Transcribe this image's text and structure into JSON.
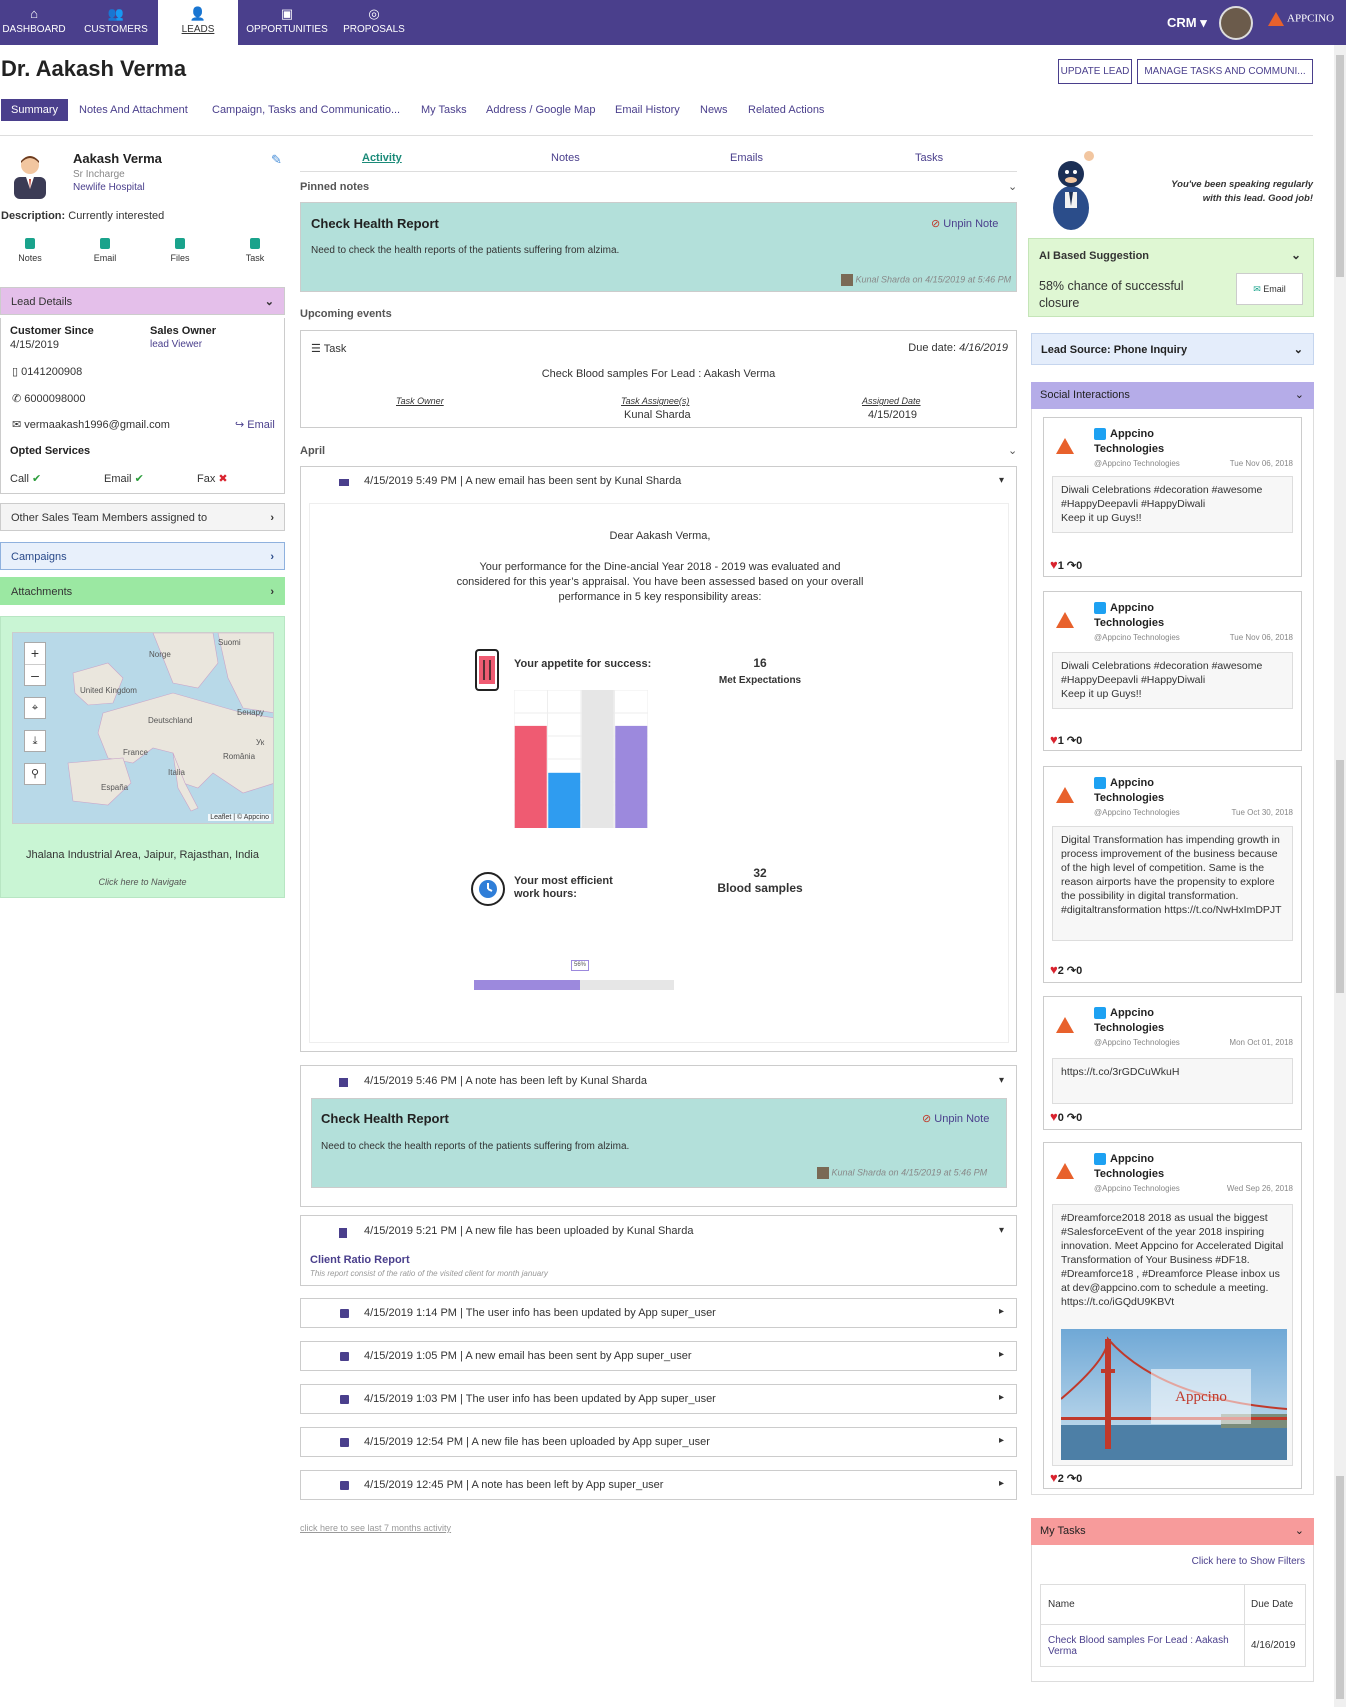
{
  "nav": {
    "items": [
      {
        "label": "DASHBOARD",
        "icon": "home-icon"
      },
      {
        "label": "CUSTOMERS",
        "icon": "users-icon"
      },
      {
        "label": "LEADS",
        "icon": "leads-icon"
      },
      {
        "label": "OPPORTUNITIES",
        "icon": "briefcase-icon"
      },
      {
        "label": "PROPOSALS",
        "icon": "handshake-icon"
      }
    ],
    "crm_label": "CRM",
    "logo_text": "APPCINO"
  },
  "header": {
    "title": "Dr. Aakash Verma",
    "update_btn": "UPDATE LEAD",
    "manage_btn": "MANAGE TASKS AND COMMUNI..."
  },
  "subtabs": [
    "Summary",
    "Notes And Attachment",
    "Campaign, Tasks and Communicatio...",
    "My Tasks",
    "Address / Google Map",
    "Email History",
    "News",
    "Related Actions"
  ],
  "profile": {
    "name": "Aakash Verma",
    "role": "Sr Incharge",
    "org": "Newlife Hospital",
    "desc_label": "Description:",
    "desc_value": "Currently interested",
    "actions": [
      "Notes",
      "Email",
      "Files",
      "Task"
    ]
  },
  "lead_details": {
    "title": "Lead Details",
    "customer_since_label": "Customer Since",
    "customer_since": "4/15/2019",
    "sales_owner_label": "Sales Owner",
    "sales_owner": "lead Viewer",
    "phone1": "0141200908",
    "phone2": "6000098000",
    "email": "vermaakash1996@gmail.com",
    "email_link": "Email",
    "opted_label": "Opted Services",
    "services": [
      {
        "name": "Call",
        "on": true
      },
      {
        "name": "Email",
        "on": true
      },
      {
        "name": "Fax",
        "on": false
      }
    ]
  },
  "panels": {
    "sales_team": "Other Sales Team Members assigned to",
    "campaigns": "Campaigns",
    "attachments": "Attachments"
  },
  "map": {
    "labels": [
      "Suomi",
      "Norge",
      "United Kingdom",
      "Deutschland",
      "France",
      "Italia",
      "España",
      "România",
      "Бенару",
      "Ук"
    ],
    "attribution": "Leaflet | © Appcino",
    "zoom_in": "+",
    "zoom_out": "–",
    "address": "Jhalana Industrial Area, Jaipur, Rajasthan, India",
    "navigate": "Click here to Navigate"
  },
  "center_tabs": [
    "Activity",
    "Notes",
    "Emails",
    "Tasks"
  ],
  "pinned": {
    "label": "Pinned notes",
    "title": "Check Health Report",
    "unpin": "Unpin Note",
    "body": "Need to check the health reports of the patients suffering from alzima.",
    "meta": "Kunal Sharda on 4/15/2019 at 5:46 PM"
  },
  "upcoming": {
    "label": "Upcoming events",
    "type": "Task",
    "due_label": "Due date:",
    "due": "4/16/2019",
    "subject": "Check Blood samples For Lead : Aakash Verma",
    "owner_label": "Task Owner",
    "assignee_label": "Task Assignee(s)",
    "assignee": "Kunal Sharda",
    "assigned_label": "Assigned Date",
    "assigned": "4/15/2019"
  },
  "month_label": "April",
  "email_activity": {
    "header": "4/15/2019 5:49 PM | A new email has been sent by Kunal Sharda",
    "greeting": "Dear Aakash  Verma,",
    "para": "Your performance for the Dine-ancial Year 2018 - 2019 was evaluated and considered for this year’s appraisal. You have been assessed based on your overall performance in 5 key responsibility areas:",
    "kpi1_label": "Your appetite for success:",
    "kpi1_value": "16",
    "kpi1_caption": "Met Expectations",
    "kpi2_label": "Your most efficient work hours:",
    "kpi2_value": "32",
    "kpi2_caption": "Blood samples",
    "progress_label": "56%",
    "progress": 0.53
  },
  "chart_data": {
    "type": "bar",
    "categories": [
      "",
      "",
      "",
      ""
    ],
    "values": [
      74,
      40,
      100,
      74
    ],
    "colors": [
      "#ef5b72",
      "#2f9cf0",
      "#e6e6e6",
      "#9c89dd"
    ],
    "ylim": [
      0,
      100
    ],
    "grid": true
  },
  "note_activity": {
    "header": "4/15/2019 5:46 PM | A note has been left by Kunal Sharda",
    "title": "Check Health Report",
    "unpin": "Unpin Note",
    "body": "Need to check the health reports of the patients suffering from alzima.",
    "meta": "Kunal Sharda on 4/15/2019 at 5:46 PM"
  },
  "file_activity": {
    "header": "4/15/2019 5:21 PM | A new file has been uploaded by Kunal Sharda",
    "title": "Client Ratio Report",
    "desc": "This report consist of the ratio of the visited client for month january"
  },
  "activity_rows": [
    "4/15/2019 1:14 PM | The user info has been updated by App super_user",
    "4/15/2019 1:05 PM | A new email has been sent by App super_user",
    "4/15/2019 1:03 PM | The user info has been updated by App super_user",
    "4/15/2019 12:54 PM | A new file has been uploaded by App super_user",
    "4/15/2019 12:45 PM | A note has been left by App super_user"
  ],
  "see_more": "click here to see last 7 months activity",
  "right": {
    "bubble": "You've been speaking regularly with this lead. Good job!",
    "ai_title": "AI Based Suggestion",
    "ai_text": "58% chance of successful closure",
    "ai_btn": "Email",
    "lead_source": "Lead Source: Phone Inquiry",
    "social_title": "Social Interactions",
    "tweets": [
      {
        "name": "Appcino Technologies",
        "handle": "@Appcino Technologies",
        "date": "Tue Nov 06, 2018",
        "text": "Diwali Celebrations #decoration #awesome #HappyDeepavli #HappyDiwali\nKeep it up Guys!!",
        "likes": "1",
        "shares": "0"
      },
      {
        "name": "Appcino Technologies",
        "handle": "@Appcino Technologies",
        "date": "Tue Nov 06, 2018",
        "text": "Diwali Celebrations #decoration #awesome #HappyDeepavli #HappyDiwali\nKeep it up Guys!!",
        "likes": "1",
        "shares": "0"
      },
      {
        "name": "Appcino Technologies",
        "handle": "@Appcino Technologies",
        "date": "Tue Oct 30, 2018",
        "text": "Digital Transformation has impending growth in process improvement of the business because of the high level of competition. Same is the reason airports have the propensity to explore the possibility in digital transformation. #digitaltransformation https://t.co/NwHxImDPJT",
        "likes": "2",
        "shares": "0"
      },
      {
        "name": "Appcino Technologies",
        "handle": "@Appcino Technologies",
        "date": "Mon Oct 01, 2018",
        "text": "https://t.co/3rGDCuWkuH",
        "likes": "0",
        "shares": "0"
      },
      {
        "name": "Appcino Technologies",
        "handle": "@Appcino Technologies",
        "date": "Wed Sep 26, 2018",
        "text": "#Dreamforce2018 2018 as usual the biggest #SalesforceEvent of the year 2018 inspiring innovation. Meet Appcino for Accelerated Digital Transformation of Your Business #DF18. #Dreamforce18 , #Dreamforce Please inbox us at dev@appcino.com to schedule a meeting. https://t.co/iGQdU9KBVt",
        "likes": "2",
        "shares": "0",
        "image_text": "Appcino"
      }
    ],
    "tasks_title": "My Tasks",
    "filters": "Click here to Show Filters",
    "tasks_cols": [
      "Name",
      "Due Date"
    ],
    "tasks_rows": [
      {
        "name": "Check Blood samples For Lead : Aakash Verma",
        "due": "4/16/2019"
      }
    ]
  }
}
